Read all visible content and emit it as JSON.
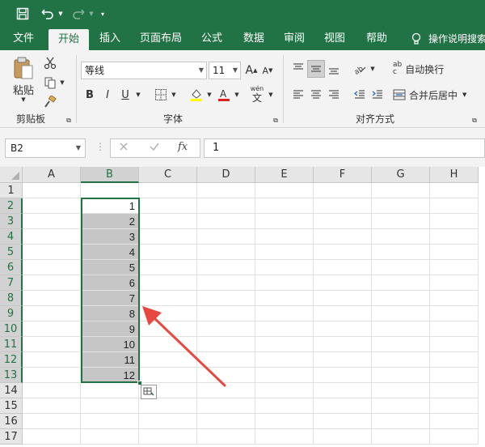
{
  "quick_access": {
    "save_icon": "save-icon",
    "undo_icon": "undo-icon",
    "redo_icon": "redo-icon",
    "customize_icon": "customize-icon"
  },
  "tabs": [
    "文件",
    "开始",
    "插入",
    "页面布局",
    "公式",
    "数据",
    "审阅",
    "视图",
    "帮助"
  ],
  "tell_me": "操作说明搜索",
  "ribbon": {
    "paste_label": "粘贴",
    "clipboard_group": "剪贴板",
    "font_name": "等线",
    "font_size": "11",
    "grow_font": "A",
    "shrink_font": "A",
    "bold": "B",
    "italic": "I",
    "underline": "U",
    "phonetic_top": "wén",
    "phonetic_bottom": "文",
    "font_group": "字体",
    "wrap_text": "自动换行",
    "merge_center": "合并后居中",
    "alignment_group": "对齐方式",
    "ab_top": "ab",
    "ab_bottom": "c"
  },
  "formula_bar": {
    "name_box": "B2",
    "fx_label": "fx",
    "formula": "1"
  },
  "columns": [
    "A",
    "B",
    "C",
    "D",
    "E",
    "F",
    "G",
    "H"
  ],
  "rows": [
    "1",
    "2",
    "3",
    "4",
    "5",
    "6",
    "7",
    "8",
    "9",
    "10",
    "11",
    "12",
    "13",
    "14",
    "15",
    "16",
    "17"
  ],
  "column_b_values": [
    "",
    "1",
    "2",
    "3",
    "4",
    "5",
    "6",
    "7",
    "8",
    "9",
    "10",
    "11",
    "12",
    "",
    "",
    "",
    ""
  ],
  "selection": {
    "column": "B",
    "from_row": 2,
    "to_row": 13
  },
  "colors": {
    "excel_green": "#217346",
    "highlight_gray": "#c6c6c6",
    "arrow_red": "#e5493f"
  }
}
